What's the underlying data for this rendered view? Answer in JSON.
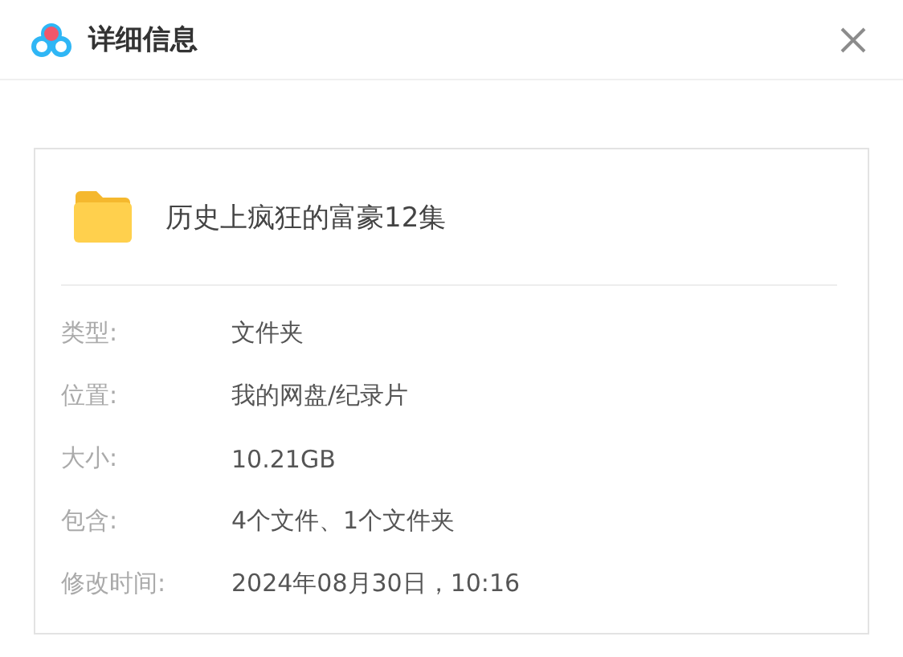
{
  "window": {
    "title": "详细信息"
  },
  "file": {
    "name": "历史上疯狂的富豪12集"
  },
  "details": [
    {
      "label": "类型:",
      "value": "文件夹"
    },
    {
      "label": "位置:",
      "value": "我的网盘/纪录片"
    },
    {
      "label": "大小:",
      "value": "10.21GB"
    },
    {
      "label": "包含:",
      "value": "4个文件、1个文件夹"
    },
    {
      "label": "修改时间:",
      "value": "2024年08月30日，10:16"
    }
  ]
}
